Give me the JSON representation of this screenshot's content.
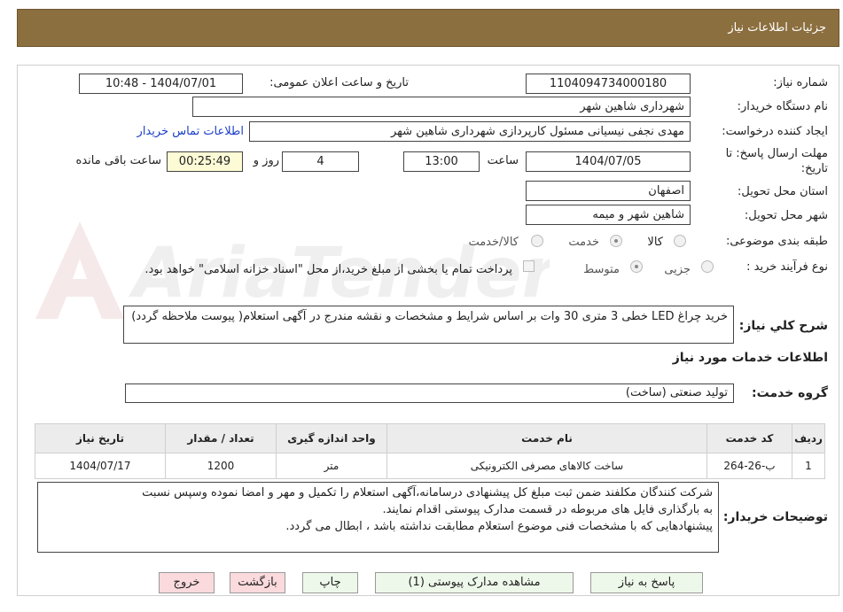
{
  "header": {
    "title": "جزئیات اطلاعات نیاز"
  },
  "labels": {
    "need_number": "شماره نیاز:",
    "announce_datetime": "تاریخ و ساعت اعلان عمومی:",
    "buyer_org": "نام دستگاه خریدار:",
    "requester": "ایجاد کننده درخواست:",
    "deadline_1": "مهلت ارسال پاسخ: تا",
    "deadline_2": "تاریخ:",
    "time": "ساعت",
    "days_and": "روز و",
    "time_remaining": "ساعت باقی مانده",
    "province": "استان محل تحویل:",
    "city": "شهر محل تحویل:",
    "category": "طبقه بندی موضوعی:",
    "purchase_type": "نوع فرآیند خرید :",
    "general_desc": "شرح كلي نياز:",
    "services_info": "اطلاعات خدمات مورد نیاز",
    "service_group": "گروه خدمت:",
    "buyer_notes": "توضیحات خریدار:"
  },
  "fields": {
    "need_number": "1104094734000180",
    "announce_datetime": "1404/07/01 - 10:48",
    "buyer_org": "شهرداری شاهین شهر",
    "requester": "مهدی نجفی نیسیانی مسئول کارپردازی شهرداری شاهین شهر",
    "contact_link": "اطلاعات تماس خریدار",
    "deadline_date": "1404/07/05",
    "deadline_time": "13:00",
    "days": "4",
    "remaining": "00:25:49",
    "province": "اصفهان",
    "city": "شاهین شهر و میمه",
    "general_desc": "خرید چراغ LED خطی 3 متری 30 وات بر اساس شرایط و مشخصات و نقشه مندرج در آگهی استعلام( پیوست ملاحظه گردد)",
    "service_group": "تولید صنعتی (ساخت)",
    "buyer_notes_1": "شرکت کنندگان مکلفند ضمن ثبت مبلغ کل پیشنهادی درسامانه،آگهی استعلام را  تکمیل و مهر و امضا نموده وسپس نسبت",
    "buyer_notes_2": "به بارگذاری فایل های مربوطه در قسمت مدارک پیوستی اقدام نمایند.",
    "buyer_notes_3": "پیشنهادهایی که با مشخصات فنی موضوع استعلام مطابقت نداشته باشد ، ابطال می گردد."
  },
  "category_options": [
    {
      "label": "کالا",
      "selected": false
    },
    {
      "label": "خدمت",
      "selected": true
    },
    {
      "label": "کالا/خدمت",
      "selected": false
    }
  ],
  "purchase_options": [
    {
      "label": "جزیی",
      "selected": false
    },
    {
      "label": "متوسط",
      "selected": true
    }
  ],
  "treasury_note": "پرداخت تمام یا بخشی از مبلغ خرید،از محل \"اسناد خزانه اسلامی\" خواهد بود.",
  "table": {
    "headers": [
      "ردیف",
      "کد خدمت",
      "نام خدمت",
      "واحد اندازه گیری",
      "تعداد / مقدار",
      "تاریخ نیاز"
    ],
    "rows": [
      [
        "1",
        "ب-26-264",
        "ساخت کالاهای مصرفی الکترونیکی",
        "متر",
        "1200",
        "1404/07/17"
      ]
    ]
  },
  "buttons": {
    "reply": "پاسخ به نیاز",
    "attachments": "مشاهده مدارک پیوستی (1)",
    "print": "چاپ",
    "back": "بازگشت",
    "exit": "خروج"
  },
  "watermark": "AriaTender.neT"
}
